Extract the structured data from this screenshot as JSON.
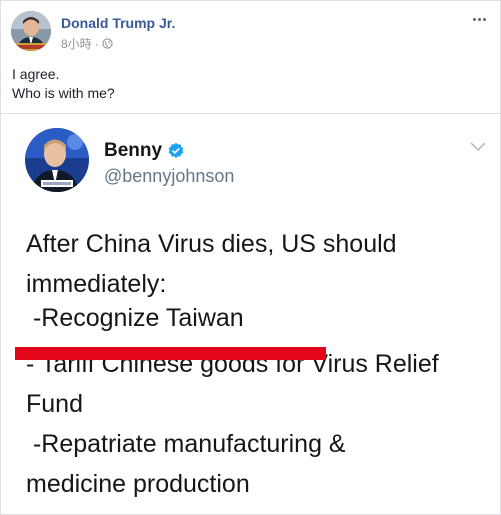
{
  "fb_post": {
    "author": "Donald Trump Jr.",
    "time": "8小時",
    "separator": "·",
    "privacy_icon": "globe-icon",
    "more_icon": "more-dots-icon",
    "text_lines": [
      "I agree.",
      "Who is with me?"
    ]
  },
  "tweet": {
    "name": "Benny",
    "handle": "@bennyjohnson",
    "verified_icon": "verified-badge-icon",
    "menu_icon": "chevron-down-icon",
    "body_lines": [
      "After China Virus dies, US should",
      "immediately:",
      "",
      " -Recognize Taiwan",
      "- Tariff Chinese goods for Virus Relief",
      "Fund",
      " -Repatriate manufacturing &",
      "medicine production"
    ]
  },
  "colors": {
    "author_link": "#385898",
    "verified_blue": "#1da1f2",
    "highlight_red": "#e3061b",
    "handle_gray": "#657786"
  }
}
